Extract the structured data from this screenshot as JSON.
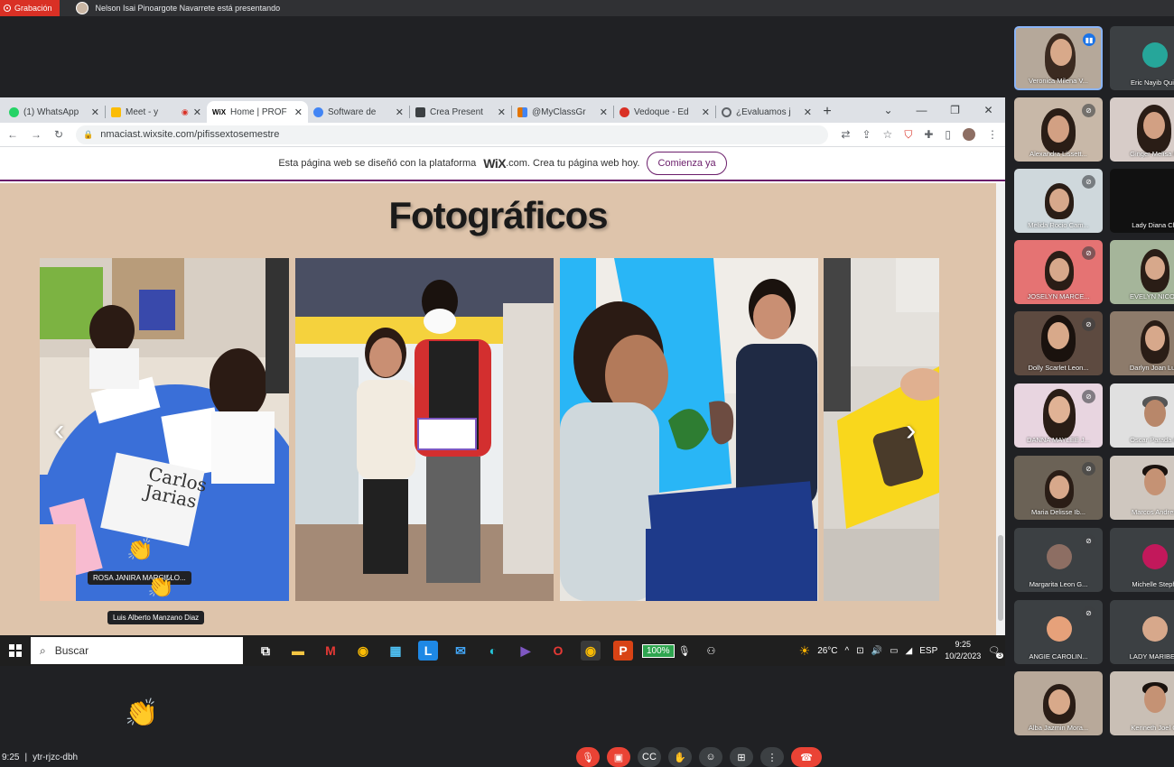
{
  "meet": {
    "recording_label": "Grabación",
    "presenting_text": "Nelson Isai Pinoargote Navarrete está presentando",
    "meeting_time": "9:25",
    "meeting_code": "ytr-rjzc-dbh"
  },
  "browser": {
    "tabs": [
      {
        "label": "(1) WhatsApp",
        "icon": "whatsapp-icon",
        "color": "#25d366"
      },
      {
        "label": "Meet - y",
        "icon": "meet-icon",
        "color": "#00897b"
      },
      {
        "label": "Home | PROF",
        "icon": "wix-icon",
        "color": "#000000"
      },
      {
        "label": "Software de",
        "icon": "software-icon",
        "color": "#4285f4"
      },
      {
        "label": "Crea Present",
        "icon": "slides-icon",
        "color": "#3c4043"
      },
      {
        "label": "@MyClassGr",
        "icon": "myclassgame-icon",
        "color": "#e37400"
      },
      {
        "label": "Vedoque - Ed",
        "icon": "vedoque-icon",
        "color": "#d93025"
      },
      {
        "label": "¿Evaluamos j",
        "icon": "globe-icon",
        "color": "#5f6368"
      }
    ],
    "active_tab_index": 2,
    "url": "nmaciast.wixsite.com/pifissextosemestre"
  },
  "wix_banner": {
    "text_before": "Esta página web se diseñó con la plataforma",
    "brand": "WiX",
    "text_after": ".com. Crea tu página web hoy.",
    "cta": "Comienza ya"
  },
  "page": {
    "title": "Fotográficos",
    "photo_text": "Carlos",
    "photo_text2": "Jarias"
  },
  "reactions": [
    {
      "name": "ROSA JANIRA MARGILLO..."
    },
    {
      "name": "Luis Alberto Manzano Diaz"
    }
  ],
  "taskbar": {
    "search_placeholder": "Buscar",
    "battery": "100%",
    "temperature": "26°C",
    "language": "ESP",
    "time": "9:25",
    "date": "10/2/2023",
    "notifications": "3"
  },
  "participants": [
    {
      "name": "Veronica Milena V...",
      "speaking": true
    },
    {
      "name": "Eric Nayib Quin"
    },
    {
      "name": "Alexandra Lissett..."
    },
    {
      "name": "Ginger Melisa R"
    },
    {
      "name": "Melida Rocio Cam..."
    },
    {
      "name": "Lady Diana Ch"
    },
    {
      "name": "JOSELYN MARCE..."
    },
    {
      "name": "EVELYN NICOL"
    },
    {
      "name": "Dolly Scarlet Leon..."
    },
    {
      "name": "Darlyn Joan Luc"
    },
    {
      "name": "DANNA MAYLEE J..."
    },
    {
      "name": "Oscar Parada C"
    },
    {
      "name": "Maria Delisse Ib..."
    },
    {
      "name": "Marcos Andres"
    },
    {
      "name": "Margarita Leon G..."
    },
    {
      "name": "Michelle Steph"
    },
    {
      "name": "ANGIE CAROLIN..."
    },
    {
      "name": "LADY MARIBEL"
    },
    {
      "name": "Alba Jazmin Mora..."
    },
    {
      "name": "Kenneth Joel C"
    }
  ]
}
